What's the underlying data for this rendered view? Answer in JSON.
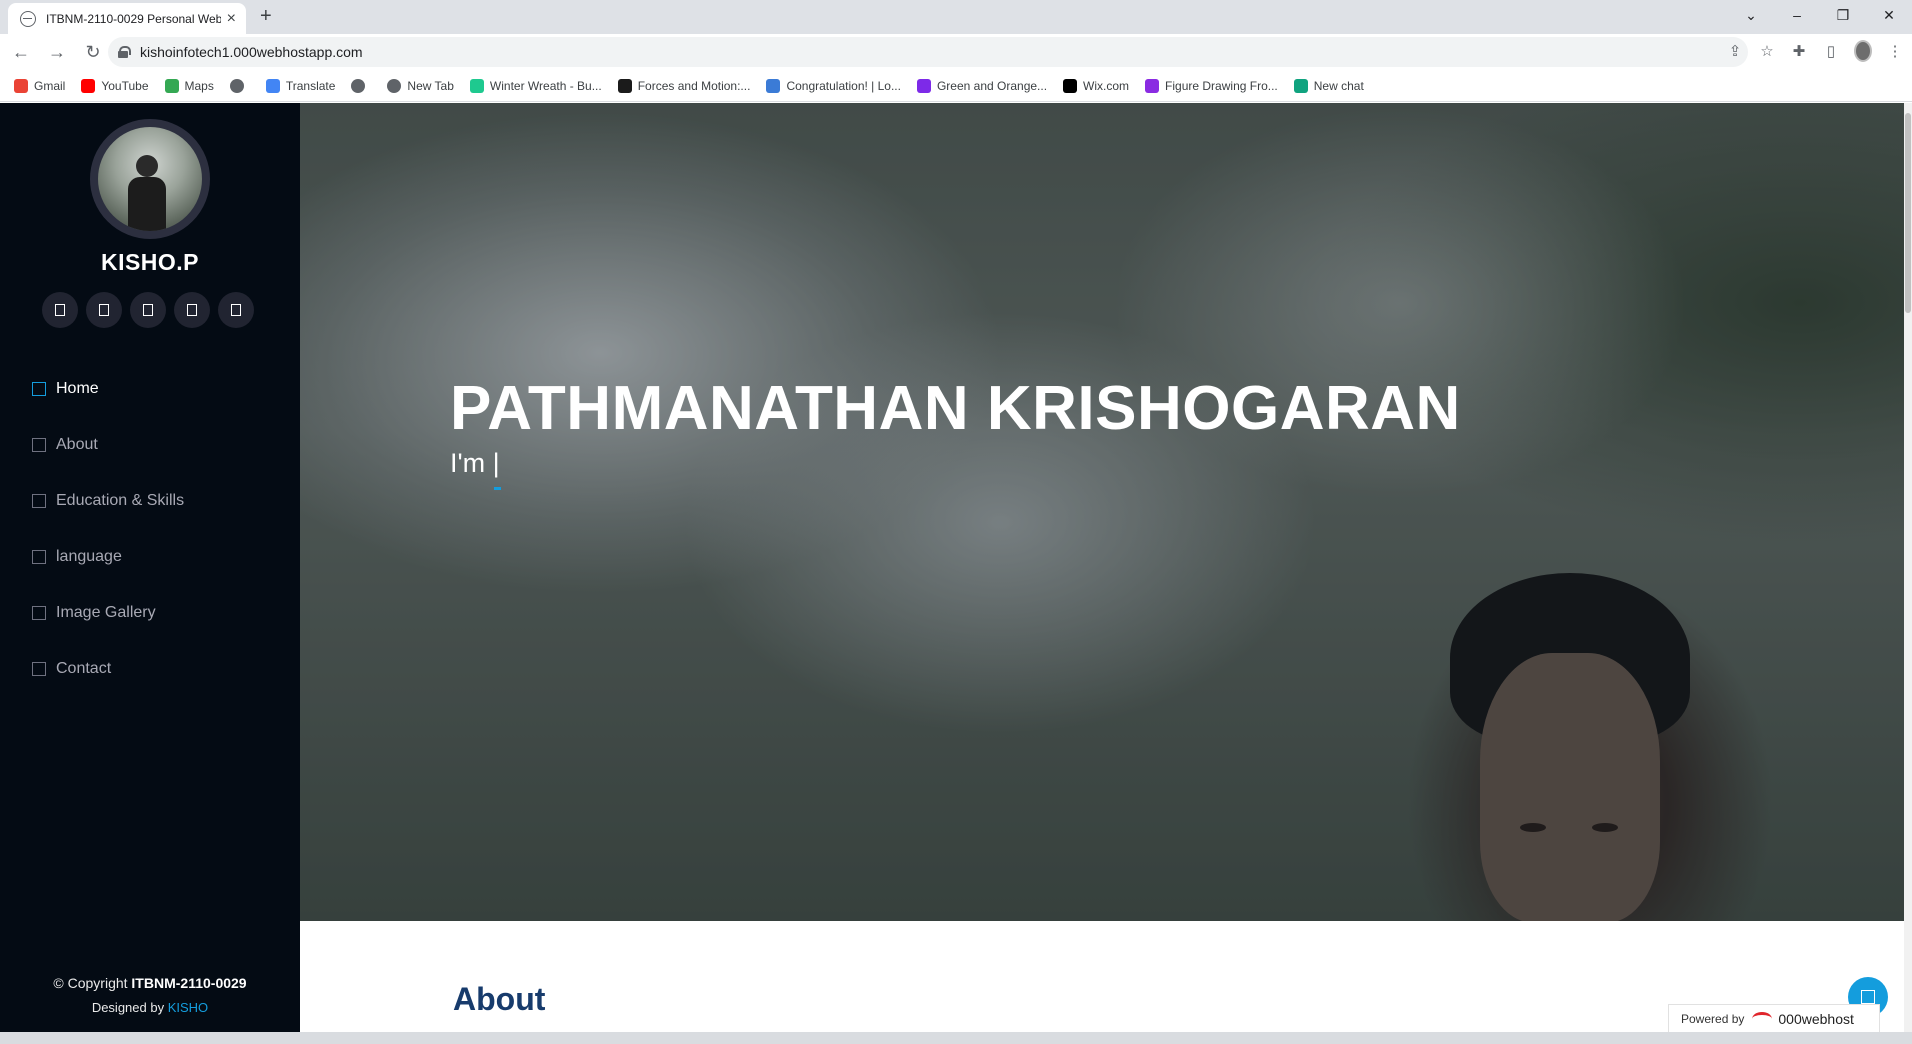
{
  "browser": {
    "tab_title": "ITBNM-2110-0029 Personal Web",
    "url": "kishoinfotech1.000webhostapp.com",
    "bookmarks": [
      {
        "label": "Gmail",
        "color": "#ea4335"
      },
      {
        "label": "YouTube",
        "color": "#ff0000"
      },
      {
        "label": "Maps",
        "color": "#34a853"
      },
      {
        "label": "",
        "color": "#5f6368"
      },
      {
        "label": "Translate",
        "color": "#4285f4"
      },
      {
        "label": "",
        "color": "#5f6368"
      },
      {
        "label": "New Tab",
        "color": "#5f6368"
      },
      {
        "label": "Winter Wreath - Bu...",
        "color": "#1ec98f"
      },
      {
        "label": "Forces and Motion:...",
        "color": "#1b1b1b"
      },
      {
        "label": "Congratulation! | Lo...",
        "color": "#3b7bd6"
      },
      {
        "label": "Green and Orange...",
        "color": "#7d2ae8"
      },
      {
        "label": "Wix.com",
        "color": "#000000"
      },
      {
        "label": "Figure Drawing Fro...",
        "color": "#8a2be2"
      },
      {
        "label": "New chat",
        "color": "#10a37f"
      }
    ]
  },
  "sidebar": {
    "name": "KISHO.P",
    "social_icons": [
      "twitter-icon",
      "facebook-icon",
      "instagram-icon",
      "skype-icon",
      "linkedin-icon"
    ],
    "menu": [
      {
        "label": "Home",
        "active": true
      },
      {
        "label": "About",
        "active": false
      },
      {
        "label": "Education & Skills",
        "active": false
      },
      {
        "label": "language",
        "active": false
      },
      {
        "label": "Image Gallery",
        "active": false
      },
      {
        "label": "Contact",
        "active": false
      }
    ],
    "copyright_prefix": "© Copyright ",
    "copyright_owner": "ITBNM-2110-0029",
    "designed_prefix": "Designed by ",
    "designed_by": "KISHO"
  },
  "hero": {
    "title": "PATHMANATHAN KRISHOGARAN",
    "subtitle": "I'm |"
  },
  "about": {
    "heading": "About"
  },
  "footer_badge": {
    "prefix": "Powered by",
    "brand": "000webhost"
  },
  "colors": {
    "accent": "#149ddd",
    "sidebar_bg": "#040b14",
    "heading": "#173b6c"
  }
}
